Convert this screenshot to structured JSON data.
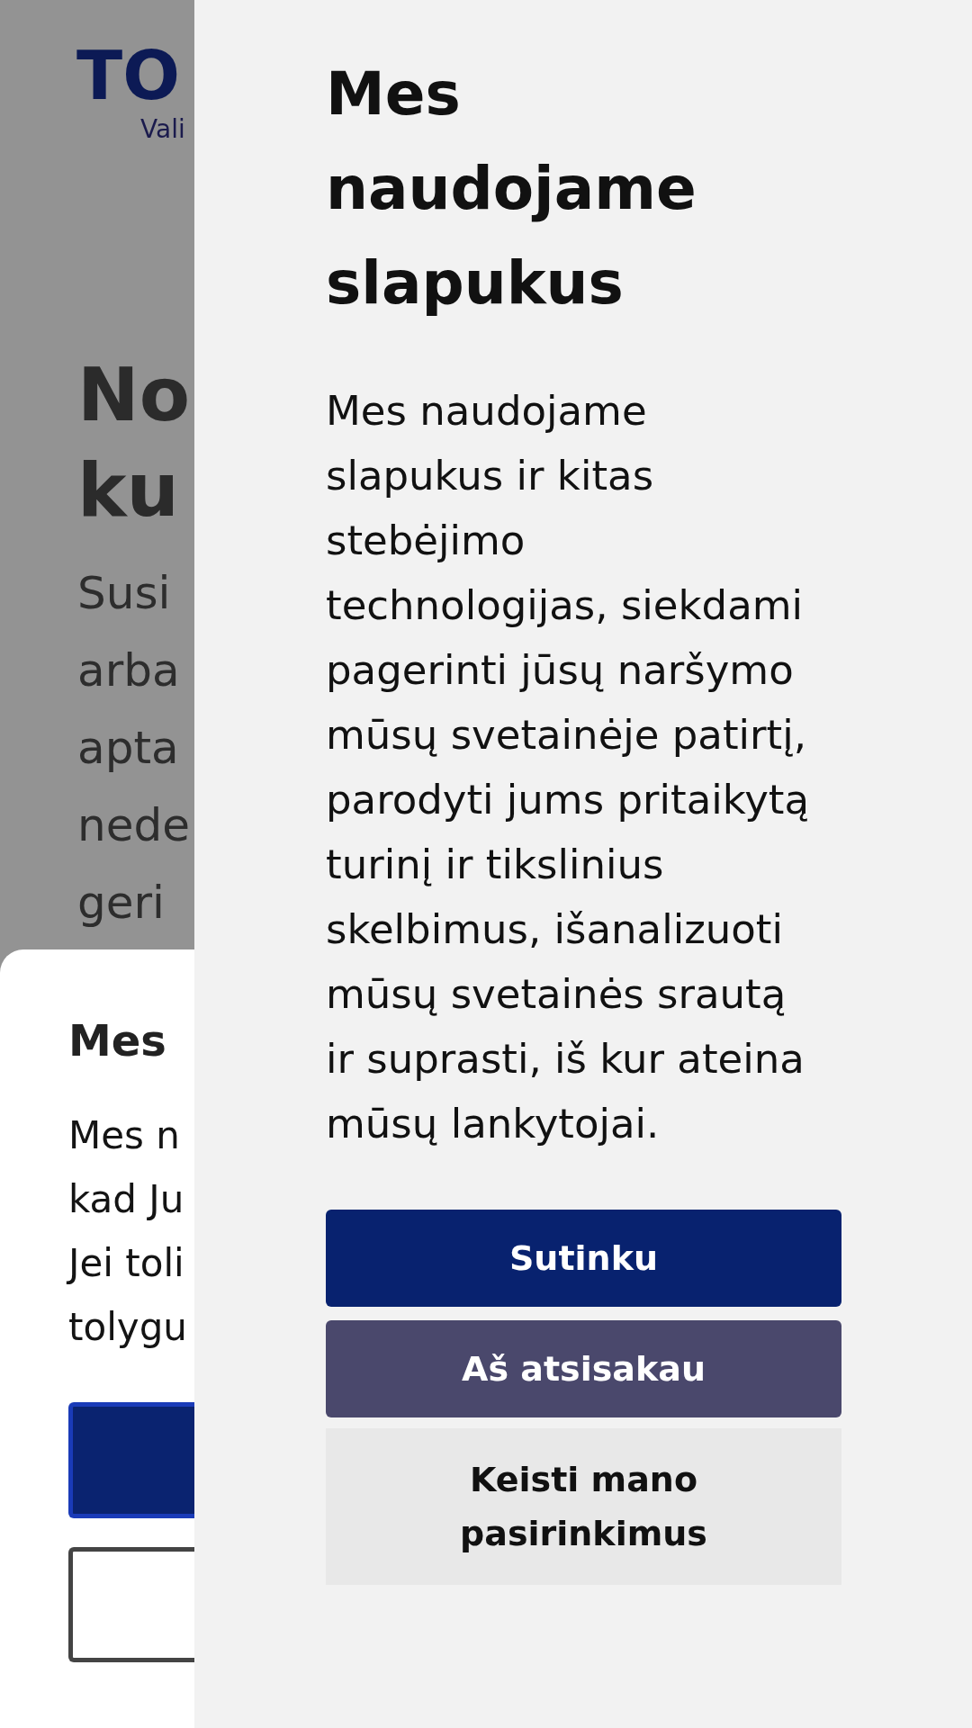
{
  "background_page": {
    "logo": {
      "wordmark": "TO",
      "tagline": "Vali"
    },
    "heading_lines": [
      "No",
      "ku"
    ],
    "text_lines": [
      "Susi",
      "arba",
      "apta",
      "nede",
      "geri"
    ]
  },
  "notice_banner": {
    "title": "Mes",
    "text_lines": [
      "Mes n",
      "kad Ju",
      "Jei toli",
      "tolygu"
    ],
    "buttons": [
      {
        "kind": "filled"
      },
      {
        "kind": "outlined"
      }
    ]
  },
  "cookie_panel": {
    "title": "Mes naudojame slapukus",
    "text": "Mes naudojame slapukus ir kitas stebėjimo technologijas, siekdami pagerinti jūsų naršymo mūsų svetainėje patirtį, parodyti jums pritaikytą turinį ir tikslinius skelbimus, išanalizuoti mūsų svetainės srautą ir suprasti, iš kur ateina mūsų lankytojai.",
    "buttons": [
      {
        "label": "Sutinku",
        "kind": "primary"
      },
      {
        "label": "Aš atsisakau",
        "kind": "secondary"
      },
      {
        "label": "Keisti mano pasirinkimus",
        "kind": "plain"
      }
    ]
  }
}
